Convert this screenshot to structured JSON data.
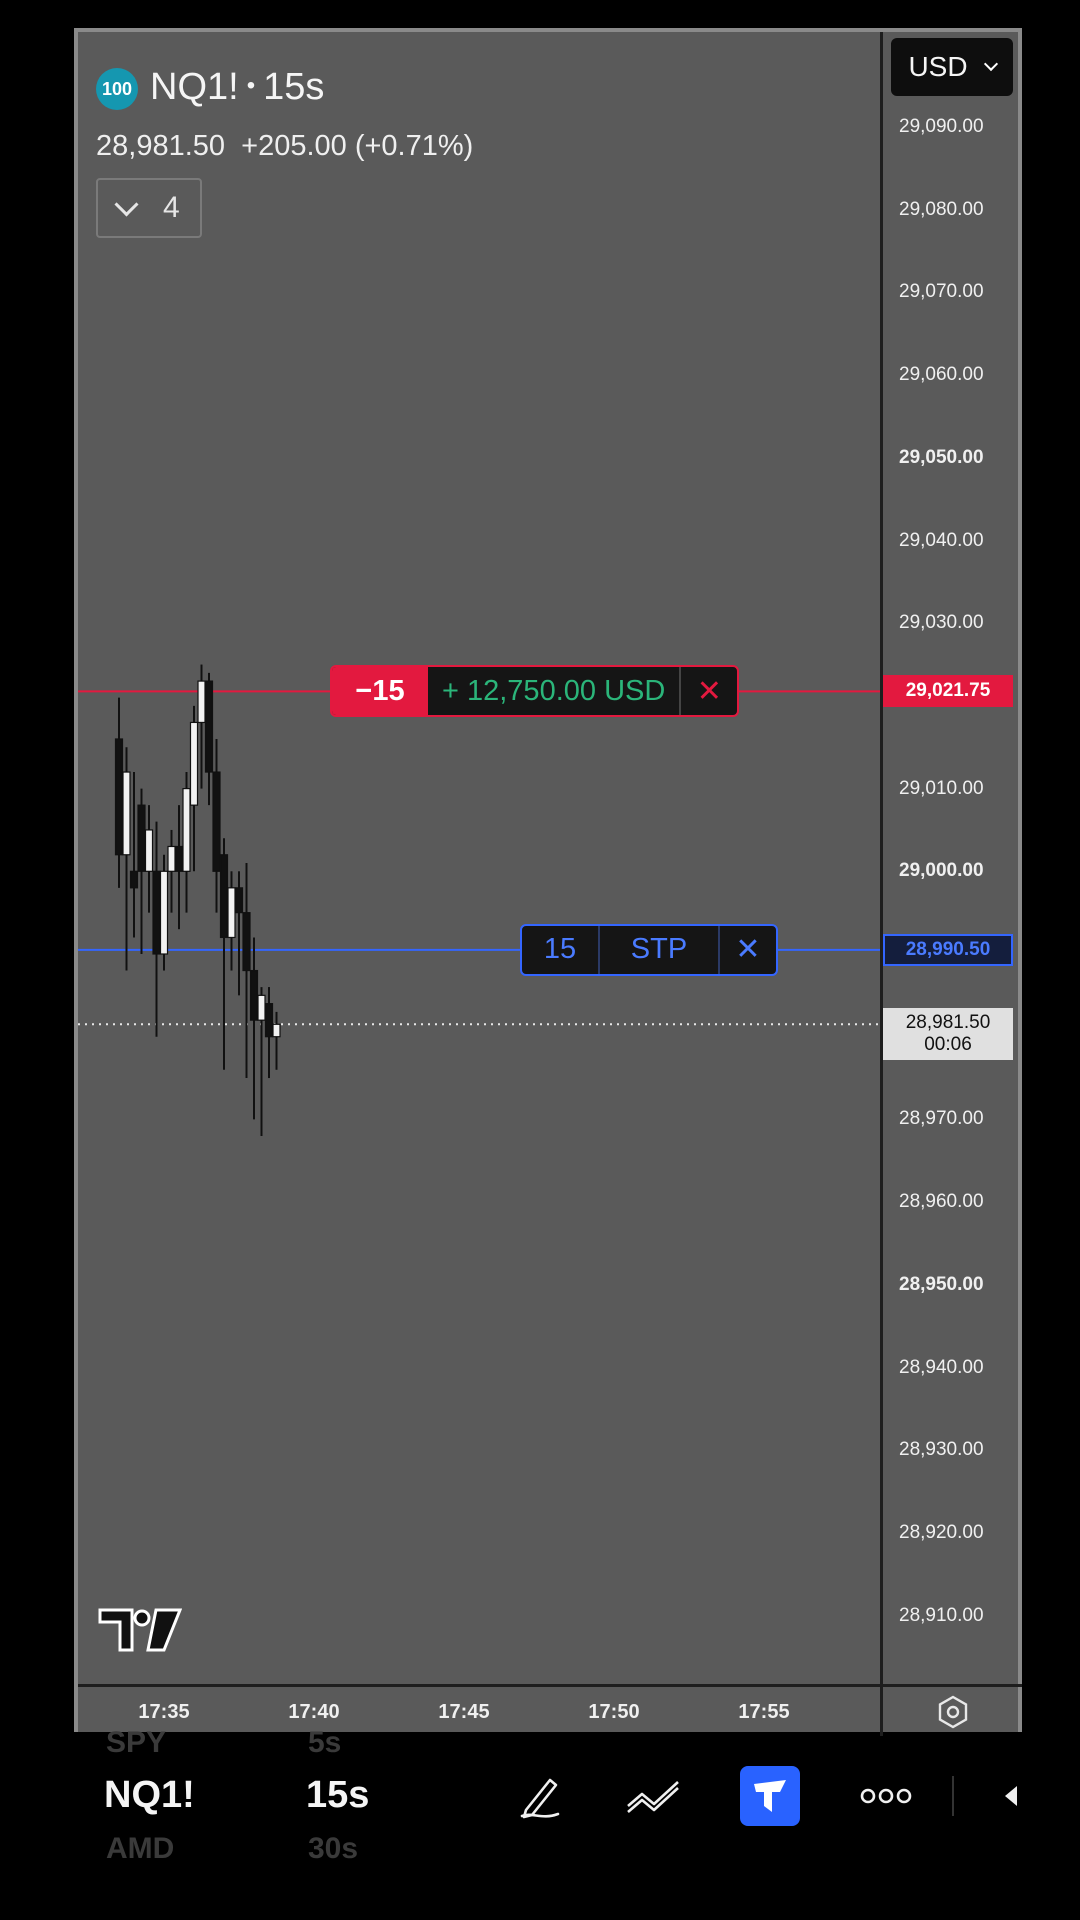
{
  "header": {
    "badge": "100",
    "symbol": "NQ1!",
    "interval": "15s",
    "last_price": "28,981.50",
    "change": "+205.00 (+0.71%)",
    "collapsed_count": "4"
  },
  "currency_button": {
    "label": "USD"
  },
  "price_ticks": [
    {
      "label": "29,090.00",
      "value": 29090,
      "bold": false
    },
    {
      "label": "29,080.00",
      "value": 29080,
      "bold": false
    },
    {
      "label": "29,070.00",
      "value": 29070,
      "bold": false
    },
    {
      "label": "29,060.00",
      "value": 29060,
      "bold": false
    },
    {
      "label": "29,050.00",
      "value": 29050,
      "bold": true
    },
    {
      "label": "29,040.00",
      "value": 29040,
      "bold": false
    },
    {
      "label": "29,030.00",
      "value": 29030,
      "bold": false
    },
    {
      "label": "29,010.00",
      "value": 29010,
      "bold": false
    },
    {
      "label": "29,000.00",
      "value": 29000,
      "bold": true
    },
    {
      "label": "28,970.00",
      "value": 28970,
      "bold": false
    },
    {
      "label": "28,960.00",
      "value": 28960,
      "bold": false
    },
    {
      "label": "28,950.00",
      "value": 28950,
      "bold": true
    },
    {
      "label": "28,940.00",
      "value": 28940,
      "bold": false
    },
    {
      "label": "28,930.00",
      "value": 28930,
      "bold": false
    },
    {
      "label": "28,920.00",
      "value": 28920,
      "bold": false
    },
    {
      "label": "28,910.00",
      "value": 28910,
      "bold": false
    }
  ],
  "position": {
    "price_label": "29,021.75",
    "price": 29021.75,
    "qty": "−15",
    "pnl": "+ 12,750.00 USD",
    "close_glyph": "✕",
    "color": "#e3193f"
  },
  "stop_order": {
    "price_label": "28,990.50",
    "price": 28990.5,
    "qty": "15",
    "type": "STP",
    "close_glyph": "✕",
    "color": "#3466ff"
  },
  "last_price_tag": {
    "price": "28,981.50",
    "countdown": "00:06",
    "value": 28981.5
  },
  "time_ticks": [
    "17:35",
    "17:40",
    "17:45",
    "17:50",
    "17:55"
  ],
  "bottom_bar": {
    "symbols": {
      "prev": "SPY",
      "current": "NQ1!",
      "next": "AMD"
    },
    "intervals": {
      "prev": "5s",
      "current": "15s",
      "next": "30s"
    },
    "tools": [
      "pen-icon",
      "trend-lines-icon",
      "trading-panel-icon",
      "more-icon",
      "collapse-arrow-icon"
    ]
  },
  "chart_data": {
    "type": "candlestick",
    "y_range": [
      28902,
      29095
    ],
    "x_range": [
      "17:33:30",
      "17:58:00"
    ],
    "candles": [
      {
        "t": "17:33:30",
        "o": 29016,
        "h": 29021,
        "c": 29002,
        "l": 28998
      },
      {
        "t": "17:33:45",
        "o": 29002,
        "h": 29015,
        "c": 29012,
        "l": 28988
      },
      {
        "t": "17:34:00",
        "o": 29000,
        "h": 29012,
        "c": 28998,
        "l": 28992
      },
      {
        "t": "17:34:15",
        "o": 29008,
        "h": 29010,
        "c": 29000,
        "l": 28990
      },
      {
        "t": "17:34:30",
        "o": 29000,
        "h": 29008,
        "c": 29005,
        "l": 28995
      },
      {
        "t": "17:34:45",
        "o": 29000,
        "h": 29006,
        "c": 28990,
        "l": 28980
      },
      {
        "t": "17:35:00",
        "o": 28990,
        "h": 29002,
        "c": 29000,
        "l": 28988
      },
      {
        "t": "17:35:15",
        "o": 29000,
        "h": 29005,
        "c": 29003,
        "l": 28995
      },
      {
        "t": "17:35:30",
        "o": 29003,
        "h": 29008,
        "c": 29000,
        "l": 28993
      },
      {
        "t": "17:35:45",
        "o": 29000,
        "h": 29012,
        "c": 29010,
        "l": 28995
      },
      {
        "t": "17:36:00",
        "o": 29008,
        "h": 29020,
        "c": 29018,
        "l": 29000
      },
      {
        "t": "17:36:15",
        "o": 29018,
        "h": 29025,
        "c": 29023,
        "l": 29010
      },
      {
        "t": "17:36:30",
        "o": 29023,
        "h": 29024,
        "c": 29012,
        "l": 29008
      },
      {
        "t": "17:36:45",
        "o": 29012,
        "h": 29016,
        "c": 29000,
        "l": 28995
      },
      {
        "t": "17:37:00",
        "o": 29002,
        "h": 29004,
        "c": 28992,
        "l": 28976
      },
      {
        "t": "17:37:15",
        "o": 28992,
        "h": 29000,
        "c": 28998,
        "l": 28988
      },
      {
        "t": "17:37:30",
        "o": 28998,
        "h": 29000,
        "c": 28995,
        "l": 28985
      },
      {
        "t": "17:37:45",
        "o": 28995,
        "h": 29001,
        "c": 28988,
        "l": 28975
      },
      {
        "t": "17:38:00",
        "o": 28988,
        "h": 28992,
        "c": 28982,
        "l": 28970
      },
      {
        "t": "17:38:15",
        "o": 28982,
        "h": 28986,
        "c": 28985,
        "l": 28968
      },
      {
        "t": "17:38:30",
        "o": 28984,
        "h": 28986,
        "c": 28980,
        "l": 28975
      },
      {
        "t": "17:38:45",
        "o": 28980,
        "h": 28983,
        "c": 28981.5,
        "l": 28976
      }
    ]
  }
}
